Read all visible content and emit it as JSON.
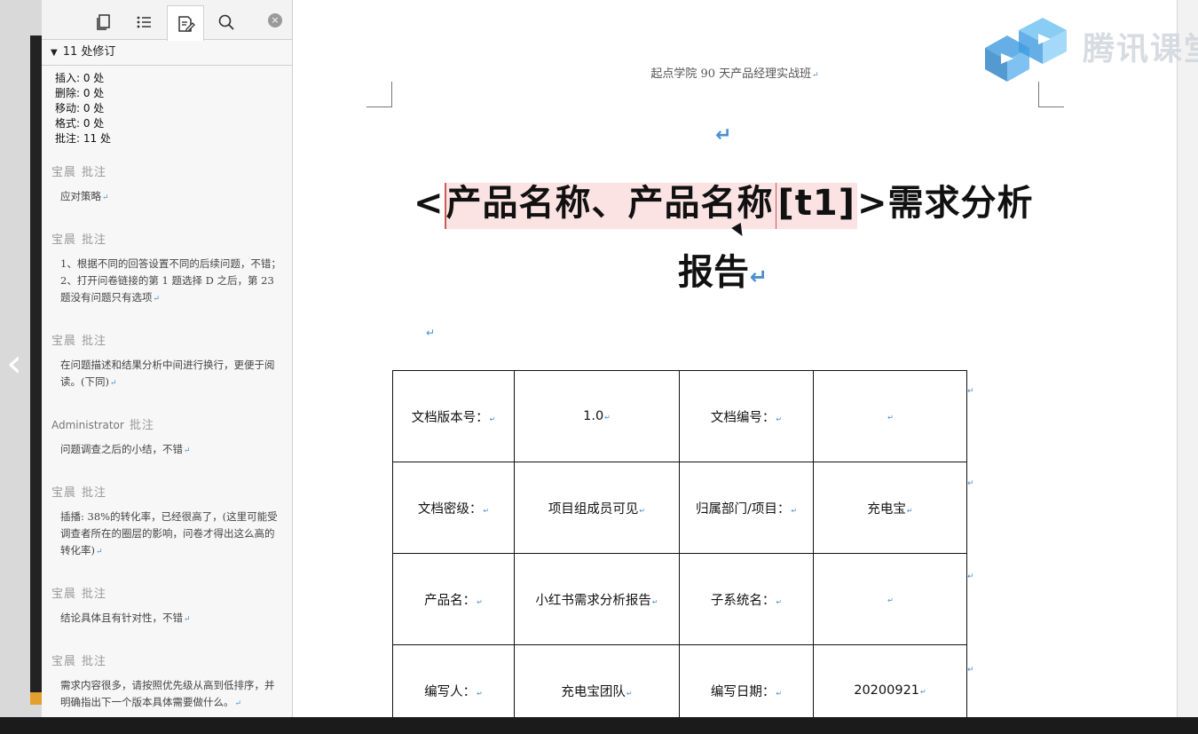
{
  "nav": {
    "prev_glyph": "‹"
  },
  "panel": {
    "tabs": [
      {
        "name": "pages",
        "icon": "document-icon"
      },
      {
        "name": "outline",
        "icon": "list-icon"
      },
      {
        "name": "revisions",
        "icon": "edit-document-icon"
      },
      {
        "name": "search",
        "icon": "search-icon"
      }
    ],
    "close_glyph": "×",
    "revisions_header": "11 处修订",
    "stats": [
      "插入: 0 处",
      "删除: 0 处",
      "移动: 0 处",
      "格式: 0 处",
      "批注: 11 处"
    ],
    "comments": [
      {
        "author": "宝晨",
        "label": "批注",
        "text": "应对策略"
      },
      {
        "author": "宝晨",
        "label": "批注",
        "text": "1、根据不同的回答设置不同的后续问题，不错；2、打开问卷链接的第 1 题选择 D 之后，第 23 题没有问题只有选项"
      },
      {
        "author": "宝晨",
        "label": "批注",
        "text": "在问题描述和结果分析中间进行换行，更便于阅读。(下同)"
      },
      {
        "author": "Administrator",
        "label": "批注",
        "text": "问题调查之后的小结，不错"
      },
      {
        "author": "宝晨",
        "label": "批注",
        "text": "插播: 38%的转化率，已经很高了，(这里可能受调查者所在的圈层的影响，问卷才得出这么高的转化率)"
      },
      {
        "author": "宝晨",
        "label": "批注",
        "text": "结论具体且有针对性，不错"
      },
      {
        "author": "宝晨",
        "label": "批注",
        "text": "需求内容很多，请按照优先级从高到低排序，并明确指出下一个版本具体需要做什么。"
      }
    ]
  },
  "document": {
    "header": "起点学院 90 天产品经理实战班",
    "title_prefix": "<",
    "title_highlight1": "产品名称、产品名称",
    "title_highlight2": "[t1]",
    "title_suffix": ">需求分析",
    "title_line2": "报告",
    "return_mark": "↵",
    "table": [
      [
        "文档版本号：",
        "1.0",
        "文档编号：",
        ""
      ],
      [
        "文档密级：",
        "项目组成员可见",
        "归属部门/项目：",
        "充电宝"
      ],
      [
        "产品名：",
        "小红书需求分析报告",
        "子系统名：",
        ""
      ],
      [
        "编写人：",
        "充电宝团队",
        "编写日期：",
        "20200921"
      ]
    ]
  },
  "watermark": {
    "text": "腾讯课堂",
    "logo_icon": "tencent-classroom-logo-icon"
  }
}
